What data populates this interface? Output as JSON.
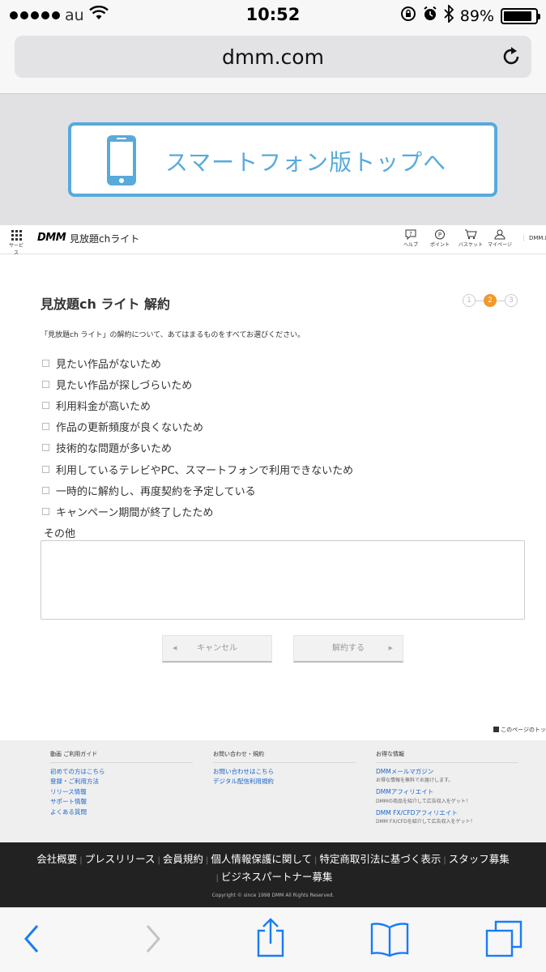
{
  "status_bar": {
    "carrier": "au",
    "time": "10:52",
    "battery": "89%",
    "battery_level": 0.89
  },
  "browser": {
    "url": "dmm.com"
  },
  "banner": {
    "text": "スマートフォン版トップへ"
  },
  "header": {
    "logo": "DMM",
    "brand": "見放題chライト",
    "services_label": "サービス",
    "icons": [
      {
        "label": "ヘルプ",
        "icon": "help-icon"
      },
      {
        "label": "ポイント",
        "icon": "point-icon"
      },
      {
        "label": "バスケット",
        "icon": "basket-icon"
      },
      {
        "label": "マイページ",
        "icon": "user-icon"
      }
    ],
    "truncated": "DMM.R"
  },
  "main": {
    "title": "見放題ch ライト 解約",
    "steps": [
      "1",
      "2",
      "3"
    ],
    "current_step": 2,
    "intro": "「見放題ch ライト」の解約について、あてはまるものをすべてお選びください。",
    "reasons": [
      "見たい作品がないため",
      "見たい作品が探しづらいため",
      "利用料金が高いため",
      "作品の更新頻度が良くないため",
      "技術的な問題が多いため",
      "利用しているテレビやPC、スマートフォンで利用できないため",
      "一時的に解約し、再度契約を予定している",
      "キャンペーン期間が終了したため"
    ],
    "other_label": "その他",
    "other_value": "",
    "cancel_button": "キャンセル",
    "submit_button": "解約する",
    "page_top": "このページのトッ"
  },
  "footer": {
    "col1": {
      "title": "動画 ご利用ガイド",
      "links": [
        "初めての方はこちら",
        "登録・ご利用方法",
        "リリース情報",
        "サポート情報",
        "よくある質問"
      ]
    },
    "col2": {
      "title": "お問い合わせ・規約",
      "links": [
        "お問い合わせはこちら",
        "デジタル配信利用規約"
      ]
    },
    "col3": {
      "title": "お得な情報",
      "items": [
        {
          "link": "DMMメールマガジン",
          "note": "お得な情報を無料でお届けします。"
        },
        {
          "link": "DMMアフィリエイト",
          "note": "DMMの商品を紹介して広告収入をゲット！"
        },
        {
          "link": "DMM FX/CFDアフィリエイト",
          "note": "DMM FX/CFDを紹介して広告収入をゲット！"
        }
      ]
    }
  },
  "corporate": {
    "links": [
      "会社概要",
      "プレスリリース",
      "会員規約",
      "個人情報保護に関して",
      "特定商取引法に基づく表示",
      "スタッフ募集",
      "ビジネスパートナー募集"
    ],
    "copyright": "Copyright © since 1998 DMM All Rights Reserved."
  },
  "colors": {
    "banner_blue": "#58aadb",
    "step_active": "#f3982a",
    "link_blue": "#1a66cc",
    "corp_bg": "#222222"
  }
}
